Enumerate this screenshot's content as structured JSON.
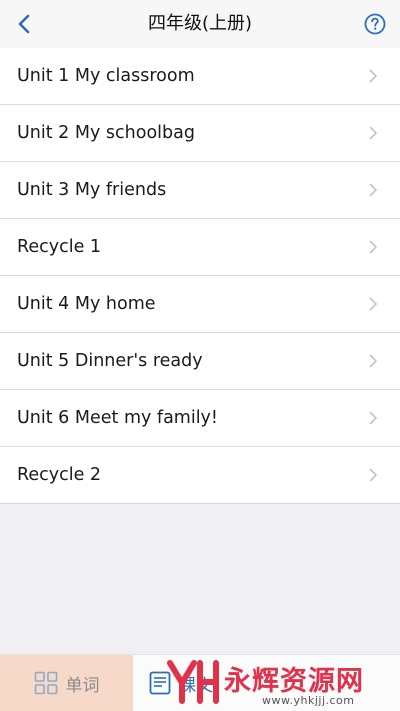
{
  "header": {
    "title": "四年级(上册)"
  },
  "units": [
    {
      "label": "Unit 1 My classroom"
    },
    {
      "label": "Unit 2 My schoolbag"
    },
    {
      "label": "Unit 3 My friends"
    },
    {
      "label": "Recycle 1"
    },
    {
      "label": "Unit 4 My home"
    },
    {
      "label": "Unit 5 Dinner's ready"
    },
    {
      "label": "Unit 6 Meet my family!"
    },
    {
      "label": "Recycle 2"
    }
  ],
  "tabs": {
    "words_label": "单词",
    "text_label": "课文"
  },
  "watermark": {
    "brand": "永辉资源网",
    "url": "www.yhkjjj.com"
  },
  "colors": {
    "accent": "#2b6fb6",
    "active_tab_bg": "#f7d9c9",
    "watermark": "#e2314a"
  }
}
